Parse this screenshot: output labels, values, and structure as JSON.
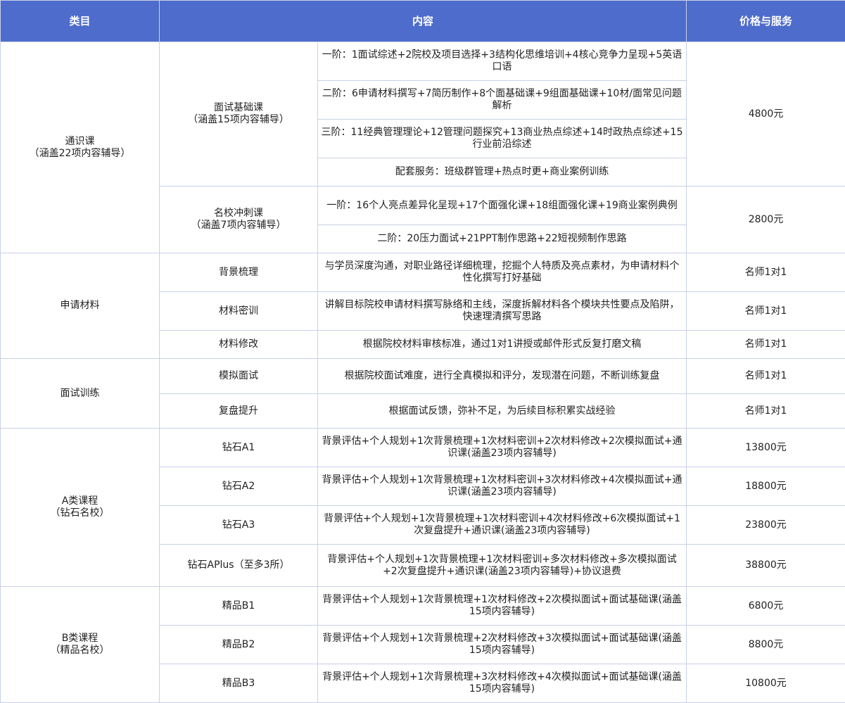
{
  "header": {
    "category": "类目",
    "content": "内容",
    "price": "价格与服务"
  },
  "sections": {
    "general": {
      "label": "通识课\n（涵盖22项内容辅导）",
      "basic": {
        "label": "面试基础课\n（涵盖15项内容辅导）",
        "price": "4800元",
        "items": [
          "一阶：1面试综述+2院校及项目选择+3结构化思维培训+4核心竞争力呈现+5英语口语",
          "二阶：6申请材料撰写+7简历制作+8个面基础课+9组面基础课+10材/面常见问题解析",
          "三阶：11经典管理理论+12管理问题探究+13商业热点综述+14时政热点综述+15行业前沿综述",
          "配套服务：班级群管理+热点时更+商业案例训练"
        ]
      },
      "sprint": {
        "label": "名校冲刺课\n（涵盖7项内容辅导）",
        "price": "2800元",
        "items": [
          "一阶：16个人亮点差异化呈现+17个面强化课+18组面强化课+19商业案例典例",
          "二阶：20压力面试+21PPT制作思路+22短视频制作思路"
        ]
      }
    },
    "materials": {
      "label": "申请材料",
      "rows": [
        {
          "name": "背景梳理",
          "content": "与学员深度沟通，对职业路径详细梳理，挖掘个人特质及亮点素材，为申请材料个性化撰写打好基础",
          "price": "名师1对1"
        },
        {
          "name": "材料密训",
          "content": "讲解目标院校申请材料撰写脉络和主线，深度拆解材料各个模块共性要点及陷阱，快速理清撰写思路",
          "price": "名师1对1"
        },
        {
          "name": "材料修改",
          "content": "根据院校材料审核标准，通过1对1讲授或邮件形式反复打磨文稿",
          "price": "名师1对1"
        }
      ]
    },
    "interview": {
      "label": "面试训练",
      "rows": [
        {
          "name": "模拟面试",
          "content": "根据院校面试难度，进行全真模拟和评分，发现潜在问题，不断训练复盘",
          "price": "名师1对1"
        },
        {
          "name": "复盘提升",
          "content": "根据面试反馈，弥补不足，为后续目标积累实战经验",
          "price": "名师1对1"
        }
      ]
    },
    "class_a": {
      "label": "A类课程\n（钻石名校）",
      "rows": [
        {
          "name": "钻石A1",
          "content": "背景评估+个人规划+1次背景梳理+1次材料密训+2次材料修改+2次模拟面试+通识课(涵盖23项内容辅导)",
          "price": "13800元"
        },
        {
          "name": "钻石A2",
          "content": "背景评估+个人规划+1次背景梳理+1次材料密训+3次材料修改+4次模拟面试+通识课(涵盖23项内容辅导)",
          "price": "18800元"
        },
        {
          "name": "钻石A3",
          "content": "背景评估+个人规划+1次背景梳理+1次材料密训+4次材料修改+6次模拟面试+1次复盘提升+通识课(涵盖23项内容辅导)",
          "price": "23800元"
        },
        {
          "name": "钻石APlus（至多3所）",
          "content": "背景评估+个人规划+1次背景梳理+1次材料密训+多次材料修改+多次模拟面试+2次复盘提升+通识课(涵盖23项内容辅导)+协议退费",
          "price": "38800元"
        }
      ]
    },
    "class_b": {
      "label": "B类课程\n（精品名校）",
      "rows": [
        {
          "name": "精品B1",
          "content": "背景评估+个人规划+1次背景梳理+1次材料修改+2次模拟面试+面试基础课(涵盖15项内容辅导)",
          "price": "6800元"
        },
        {
          "name": "精品B2",
          "content": "背景评估+个人规划+1次背景梳理+2次材料修改+3次模拟面试+面试基础课(涵盖15项内容辅导)",
          "price": "8800元"
        },
        {
          "name": "精品B3",
          "content": "背景评估+个人规划+1次背景梳理+3次材料修改+4次模拟面试+面试基础课(涵盖15项内容辅导)",
          "price": "10800元"
        }
      ]
    }
  }
}
